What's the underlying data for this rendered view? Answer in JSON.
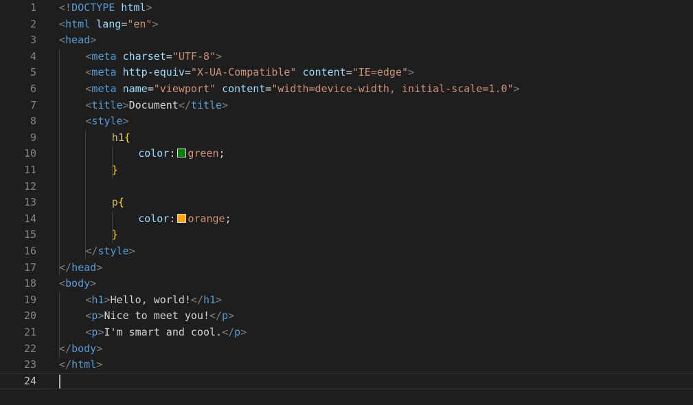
{
  "editor": {
    "lines": [
      {
        "n": "1",
        "indent": 0,
        "tokens": [
          [
            "b",
            "<!"
          ],
          [
            "g",
            "DOCTYPE"
          ],
          [
            "a",
            " html"
          ],
          [
            "b",
            ">"
          ]
        ]
      },
      {
        "n": "2",
        "indent": 0,
        "tokens": [
          [
            "b",
            "<"
          ],
          [
            "g",
            "html"
          ],
          [
            "a",
            " lang"
          ],
          [
            "t",
            "="
          ],
          [
            "s",
            "\"en\""
          ],
          [
            "b",
            ">"
          ]
        ]
      },
      {
        "n": "3",
        "indent": 0,
        "tokens": [
          [
            "b",
            "<"
          ],
          [
            "g",
            "head"
          ],
          [
            "b",
            ">"
          ]
        ]
      },
      {
        "n": "4",
        "indent": 1,
        "tokens": [
          [
            "b",
            "<"
          ],
          [
            "g",
            "meta"
          ],
          [
            "a",
            " charset"
          ],
          [
            "t",
            "="
          ],
          [
            "s",
            "\"UTF-8\""
          ],
          [
            "b",
            ">"
          ]
        ]
      },
      {
        "n": "5",
        "indent": 1,
        "tokens": [
          [
            "b",
            "<"
          ],
          [
            "g",
            "meta"
          ],
          [
            "a",
            " http-equiv"
          ],
          [
            "t",
            "="
          ],
          [
            "s",
            "\"X-UA-Compatible\""
          ],
          [
            "a",
            " content"
          ],
          [
            "t",
            "="
          ],
          [
            "s",
            "\"IE=edge\""
          ],
          [
            "b",
            ">"
          ]
        ]
      },
      {
        "n": "6",
        "indent": 1,
        "tokens": [
          [
            "b",
            "<"
          ],
          [
            "g",
            "meta"
          ],
          [
            "a",
            " name"
          ],
          [
            "t",
            "="
          ],
          [
            "s",
            "\"viewport\""
          ],
          [
            "a",
            " content"
          ],
          [
            "t",
            "="
          ],
          [
            "s",
            "\"width=device-width, initial-scale=1.0\""
          ],
          [
            "b",
            ">"
          ]
        ]
      },
      {
        "n": "7",
        "indent": 1,
        "tokens": [
          [
            "b",
            "<"
          ],
          [
            "g",
            "title"
          ],
          [
            "b",
            ">"
          ],
          [
            "t",
            "Document"
          ],
          [
            "b",
            "</"
          ],
          [
            "g",
            "title"
          ],
          [
            "b",
            ">"
          ]
        ]
      },
      {
        "n": "8",
        "indent": 1,
        "tokens": [
          [
            "b",
            "<"
          ],
          [
            "g",
            "style"
          ],
          [
            "b",
            ">"
          ]
        ]
      },
      {
        "n": "9",
        "indent": 2,
        "tokens": [
          [
            "e",
            "h1"
          ],
          [
            "y",
            "{"
          ]
        ]
      },
      {
        "n": "10",
        "indent": 3,
        "tokens": [
          [
            "p",
            "color"
          ],
          [
            "t",
            ":"
          ],
          [
            "sw",
            "#008000"
          ],
          [
            "v",
            "green"
          ],
          [
            "t",
            ";"
          ]
        ]
      },
      {
        "n": "11",
        "indent": 2,
        "tokens": [
          [
            "y",
            "}"
          ]
        ]
      },
      {
        "n": "12",
        "indent": 0,
        "tokens": []
      },
      {
        "n": "13",
        "indent": 2,
        "tokens": [
          [
            "e",
            "p"
          ],
          [
            "y",
            "{"
          ]
        ]
      },
      {
        "n": "14",
        "indent": 3,
        "tokens": [
          [
            "p",
            "color"
          ],
          [
            "t",
            ":"
          ],
          [
            "sw",
            "#ffa500"
          ],
          [
            "v",
            "orange"
          ],
          [
            "t",
            ";"
          ]
        ]
      },
      {
        "n": "15",
        "indent": 2,
        "tokens": [
          [
            "y",
            "}"
          ]
        ]
      },
      {
        "n": "16",
        "indent": 1,
        "tokens": [
          [
            "b",
            "</"
          ],
          [
            "g",
            "style"
          ],
          [
            "b",
            ">"
          ]
        ]
      },
      {
        "n": "17",
        "indent": 0,
        "tokens": [
          [
            "b",
            "</"
          ],
          [
            "g",
            "head"
          ],
          [
            "b",
            ">"
          ]
        ]
      },
      {
        "n": "18",
        "indent": 0,
        "tokens": [
          [
            "b",
            "<"
          ],
          [
            "g",
            "body"
          ],
          [
            "b",
            ">"
          ]
        ]
      },
      {
        "n": "19",
        "indent": 1,
        "tokens": [
          [
            "b",
            "<"
          ],
          [
            "g",
            "h1"
          ],
          [
            "b",
            ">"
          ],
          [
            "t",
            "Hello, world!"
          ],
          [
            "b",
            "</"
          ],
          [
            "g",
            "h1"
          ],
          [
            "b",
            ">"
          ]
        ]
      },
      {
        "n": "20",
        "indent": 1,
        "tokens": [
          [
            "b",
            "<"
          ],
          [
            "g",
            "p"
          ],
          [
            "b",
            ">"
          ],
          [
            "t",
            "Nice to meet you!"
          ],
          [
            "b",
            "</"
          ],
          [
            "g",
            "p"
          ],
          [
            "b",
            ">"
          ]
        ]
      },
      {
        "n": "21",
        "indent": 1,
        "tokens": [
          [
            "b",
            "<"
          ],
          [
            "g",
            "p"
          ],
          [
            "b",
            ">"
          ],
          [
            "t",
            "I'm smart and cool."
          ],
          [
            "b",
            "</"
          ],
          [
            "g",
            "p"
          ],
          [
            "b",
            ">"
          ]
        ]
      },
      {
        "n": "22",
        "indent": 0,
        "tokens": [
          [
            "b",
            "</"
          ],
          [
            "g",
            "body"
          ],
          [
            "b",
            ">"
          ]
        ]
      },
      {
        "n": "23",
        "indent": 0,
        "tokens": [
          [
            "b",
            "</"
          ],
          [
            "g",
            "html"
          ],
          [
            "b",
            ">"
          ]
        ]
      },
      {
        "n": "24",
        "indent": 0,
        "tokens": [],
        "current": true
      }
    ]
  },
  "colors": {
    "background": "#1e1e1e",
    "tag": "#569cd6",
    "attribute": "#9cdcfe",
    "string": "#ce9178",
    "selector": "#d7ba7d",
    "brace": "#ffd700"
  }
}
